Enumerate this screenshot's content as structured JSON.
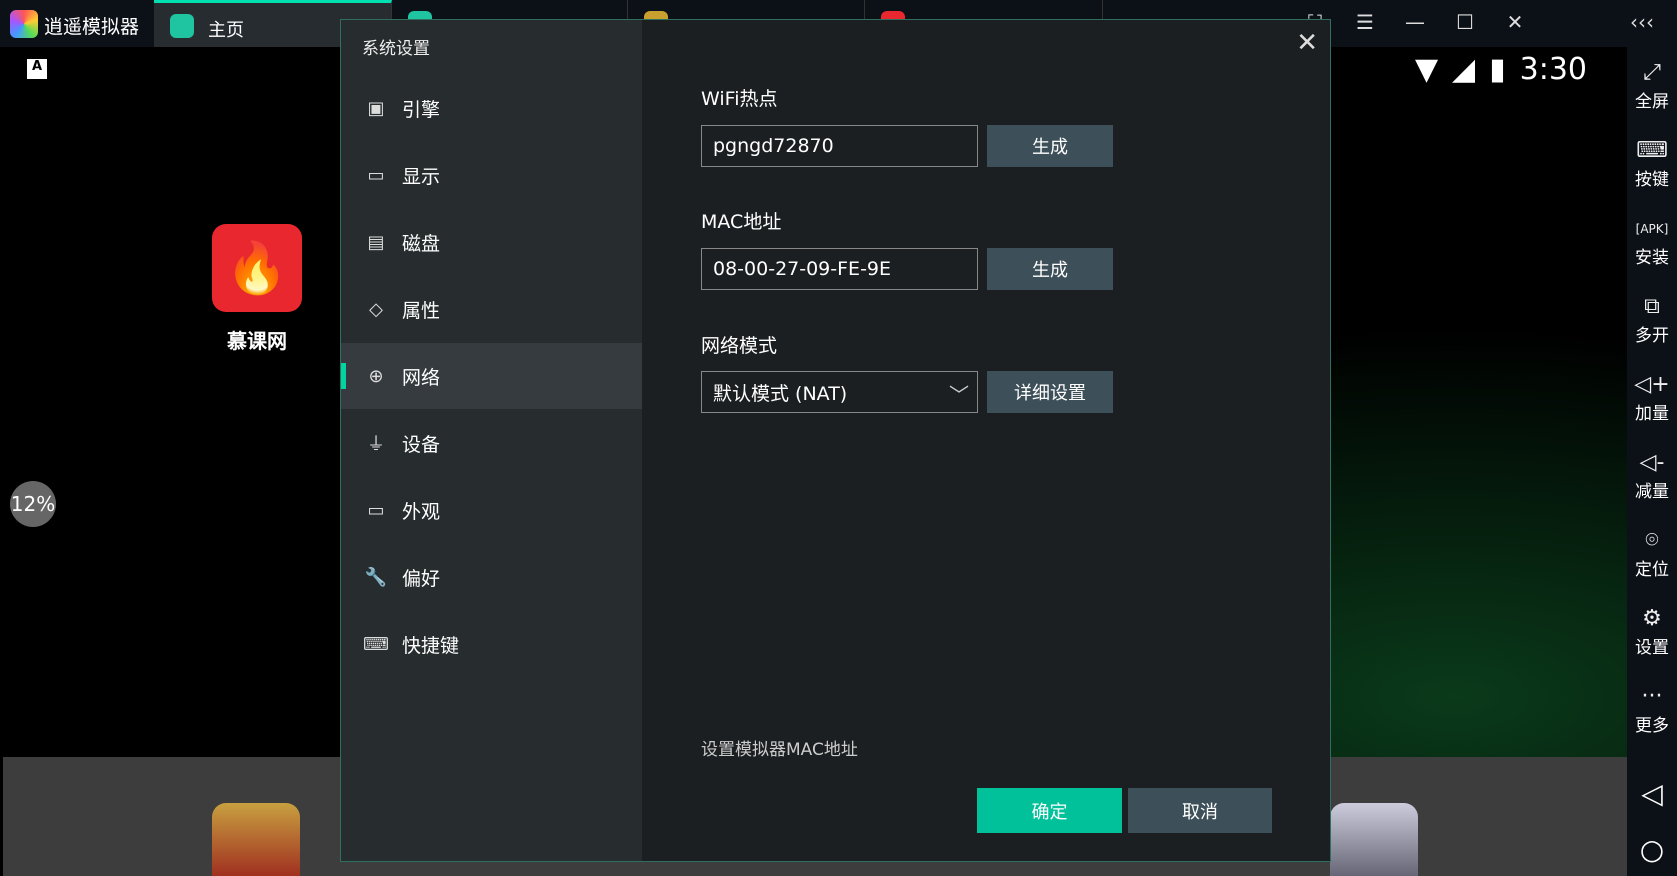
{
  "app": {
    "title": "逍遥模拟器"
  },
  "tabs": [
    {
      "label": "主页",
      "active": true,
      "color": "#1fc4a0"
    },
    {
      "color": "#1fc4a0"
    },
    {
      "color": "#c7a030"
    },
    {
      "color": "#e8282e"
    }
  ],
  "window_buttons": [
    "screenshot-icon",
    "menu-icon",
    "minimize-icon",
    "maximize-icon",
    "close-icon"
  ],
  "status": {
    "time": "3:30"
  },
  "desktop": {
    "app_label": "慕课网",
    "progress": "12%"
  },
  "toolbar": [
    {
      "icon": "fullscreen-icon",
      "label": "全屏"
    },
    {
      "icon": "keyboard-icon",
      "label": "按键"
    },
    {
      "icon": "apk-icon",
      "label": "安装"
    },
    {
      "icon": "multi-instance-icon",
      "label": "多开"
    },
    {
      "icon": "volume-up-icon",
      "label": "加量"
    },
    {
      "icon": "volume-down-icon",
      "label": "减量"
    },
    {
      "icon": "location-icon",
      "label": "定位"
    },
    {
      "icon": "settings-icon",
      "label": "设置"
    },
    {
      "icon": "more-icon",
      "label": "更多"
    }
  ],
  "dialog": {
    "title": "系统设置",
    "sidebar": [
      {
        "label": "引擎",
        "icon": "chip-icon"
      },
      {
        "label": "显示",
        "icon": "monitor-icon"
      },
      {
        "label": "磁盘",
        "icon": "disk-icon"
      },
      {
        "label": "属性",
        "icon": "tag-icon"
      },
      {
        "label": "网络",
        "icon": "globe-icon",
        "active": true
      },
      {
        "label": "设备",
        "icon": "microphone-icon"
      },
      {
        "label": "外观",
        "icon": "window-icon"
      },
      {
        "label": "偏好",
        "icon": "wrench-icon"
      },
      {
        "label": "快捷键",
        "icon": "keyboard-icon"
      }
    ],
    "wifi": {
      "label": "WiFi热点",
      "value": "pgngd72870",
      "button": "生成"
    },
    "mac": {
      "label": "MAC地址",
      "value": "08-00-27-09-FE-9E",
      "button": "生成"
    },
    "network_mode": {
      "label": "网络模式",
      "value": "默认模式 (NAT)",
      "button": "详细设置"
    },
    "hint": "设置模拟器MAC地址",
    "ok": "确定",
    "cancel": "取消",
    "accent": "#00c19a"
  }
}
